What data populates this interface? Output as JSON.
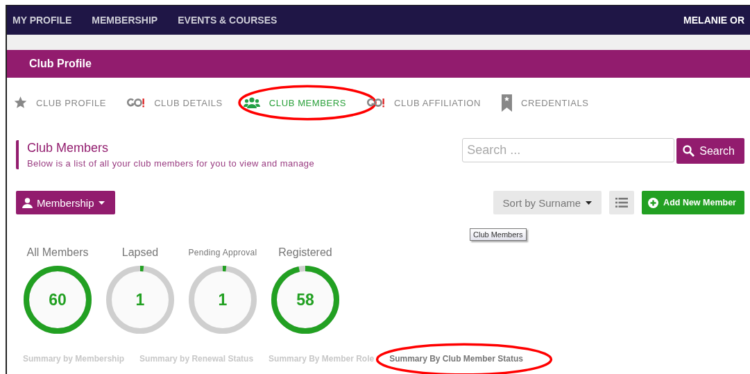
{
  "nav": {
    "items": [
      {
        "label": "MY PROFILE"
      },
      {
        "label": "MEMBERSHIP"
      },
      {
        "label": "EVENTS & COURSES"
      }
    ],
    "user": "MELANIE OR"
  },
  "page_title": "Club Profile",
  "tabs": [
    {
      "label": "CLUB PROFILE",
      "kind": "star",
      "selected": false,
      "highlighted": false
    },
    {
      "label": "CLUB DETAILS",
      "kind": "go",
      "selected": false,
      "highlighted": false
    },
    {
      "label": "CLUB MEMBERS",
      "kind": "people",
      "selected": true,
      "highlighted": true
    },
    {
      "label": "CLUB AFFILIATION",
      "kind": "go",
      "selected": false,
      "highlighted": false
    },
    {
      "label": "CREDENTIALS",
      "kind": "bookmark",
      "selected": false,
      "highlighted": false
    }
  ],
  "section": {
    "title": "Club Members",
    "subtitle": "Below is a list of all your club members for you to view and manage"
  },
  "search": {
    "placeholder": "Search ...",
    "button": "Search"
  },
  "membership_button": "Membership",
  "sort_button": "Sort by Surname",
  "add_button": "Add New Member",
  "tooltip": "Club Members",
  "stats": [
    {
      "label": "All Members",
      "value": "60",
      "level": 1
    },
    {
      "label": "Lapsed",
      "value": "1",
      "level": 0.017
    },
    {
      "label": "Pending Approval",
      "value": "1",
      "level": 0.017
    },
    {
      "label": "Registered",
      "value": "58",
      "level": 0.967
    }
  ],
  "summary_tabs": [
    {
      "label": "Summary by Membership",
      "selected": false,
      "highlighted": false
    },
    {
      "label": "Summary by Renewal Status",
      "selected": false,
      "highlighted": false
    },
    {
      "label": "Summary By Member Role",
      "selected": false,
      "highlighted": false
    },
    {
      "label": "Summary By Club Member Status",
      "selected": true,
      "highlighted": true
    }
  ]
}
